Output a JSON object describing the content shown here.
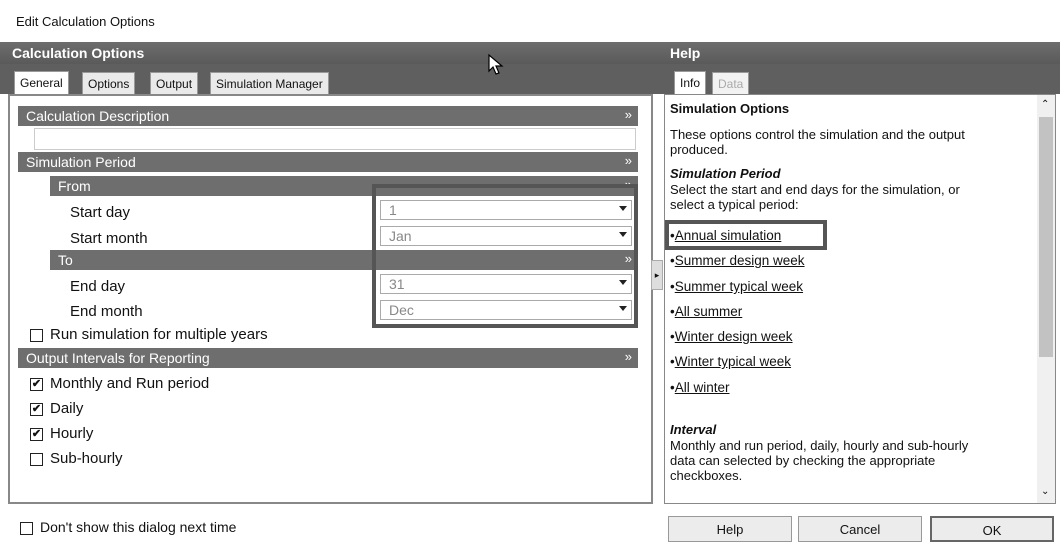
{
  "window": {
    "title": "Edit Calculation Options"
  },
  "left": {
    "header": "Calculation Options",
    "tabs": [
      {
        "label": "General",
        "active": true
      },
      {
        "label": "Options",
        "active": false
      },
      {
        "label": "Output",
        "active": false
      },
      {
        "label": "Simulation Manager",
        "active": false
      }
    ],
    "sections": {
      "calc_desc": "Calculation Description",
      "sim_period": "Simulation Period",
      "from": "From",
      "to": "To",
      "output_intervals": "Output Intervals for Reporting"
    },
    "fields": {
      "start_day_label": "Start day",
      "start_day_value": "1",
      "start_month_label": "Start month",
      "start_month_value": "Jan",
      "end_day_label": "End day",
      "end_day_value": "31",
      "end_month_label": "End month",
      "end_month_value": "Dec"
    },
    "checkboxes": {
      "multi_year": {
        "label": "Run simulation for multiple years",
        "checked": false
      },
      "monthly": {
        "label": "Monthly and Run period",
        "checked": true
      },
      "daily": {
        "label": "Daily",
        "checked": true
      },
      "hourly": {
        "label": "Hourly",
        "checked": true
      },
      "subhourly": {
        "label": "Sub-hourly",
        "checked": false
      }
    }
  },
  "right": {
    "header": "Help",
    "tabs": [
      {
        "label": "Info",
        "active": true
      },
      {
        "label": "Data",
        "active": false
      }
    ],
    "help": {
      "title": "Simulation Options",
      "intro_l1": "These options control the simulation and the output",
      "intro_l2": "produced.",
      "period_heading": "Simulation Period",
      "period_l1": "Select the start and end days for the simulation, or",
      "period_l2": "select a typical period:",
      "links": [
        "Annual simulation",
        "Summer design week",
        "Summer typical week",
        "All summer",
        "Winter design week",
        "Winter typical week",
        "All winter"
      ],
      "interval_heading": "Interval",
      "interval_l1": "Monthly and run period, daily, hourly and sub-hourly",
      "interval_l2": "data can selected by checking the appropriate",
      "interval_l3": "checkboxes."
    }
  },
  "footer": {
    "dont_show": {
      "label": "Don't show this dialog next time",
      "checked": false
    },
    "help_btn": "Help",
    "cancel_btn": "Cancel",
    "ok_btn": "OK"
  },
  "icons": {
    "chevron": "chevron-double-down-icon",
    "check": "✔"
  }
}
